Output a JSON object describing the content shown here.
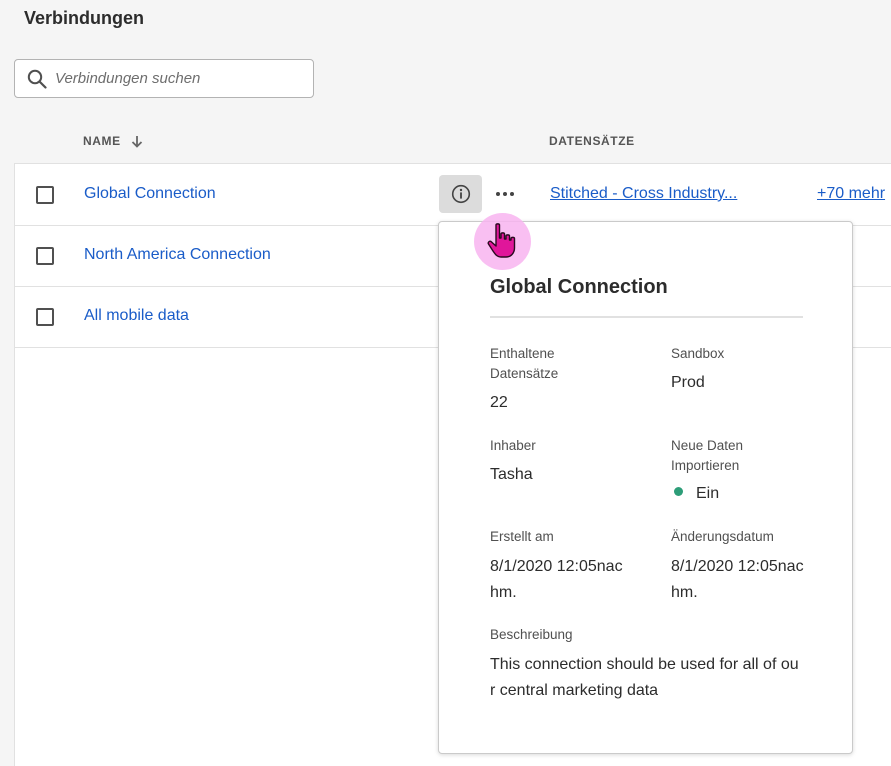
{
  "page": {
    "title": "Verbindungen"
  },
  "search": {
    "placeholder": "Verbindungen suchen"
  },
  "table": {
    "columns": {
      "name": "NAME",
      "datasets": "DATENSÄTZE"
    },
    "rows": [
      {
        "name": "Global Connection",
        "dataset": "Stitched - Cross Industry...",
        "more": "+70 mehr"
      },
      {
        "name": "North America Connection"
      },
      {
        "name": "All mobile data"
      }
    ]
  },
  "popover": {
    "title": "Global Connection",
    "fields": {
      "datasets_label_1": "Enthaltene",
      "datasets_label_2": "Datensätze",
      "datasets_value": "22",
      "sandbox_label": "Sandbox",
      "sandbox_value": "Prod",
      "owner_label": "Inhaber",
      "owner_value": "Tasha",
      "import_label_1": "Neue Daten",
      "import_label_2": "Importieren",
      "import_value": "Ein",
      "created_label": "Erstellt am",
      "created_value_1": "8/1/2020 12:05nac",
      "created_value_2": "hm.",
      "modified_label": "Änderungsdatum",
      "modified_value_1": "8/1/2020 12:05nac",
      "modified_value_2": "hm.",
      "description_label": "Beschreibung",
      "description_value_1": "This connection should be used for all of ou",
      "description_value_2": "r central marketing data"
    }
  },
  "colors": {
    "link": "#1a5cc8",
    "status_on": "#2d9d78",
    "cursor_highlight": "#f8b4f0",
    "cursor": "#e0169a"
  },
  "icons": {
    "search": "search-icon",
    "sort": "arrow-down-icon",
    "info": "info-icon",
    "more": "more-horizontal-icon",
    "cursor": "hand-pointer-icon"
  }
}
